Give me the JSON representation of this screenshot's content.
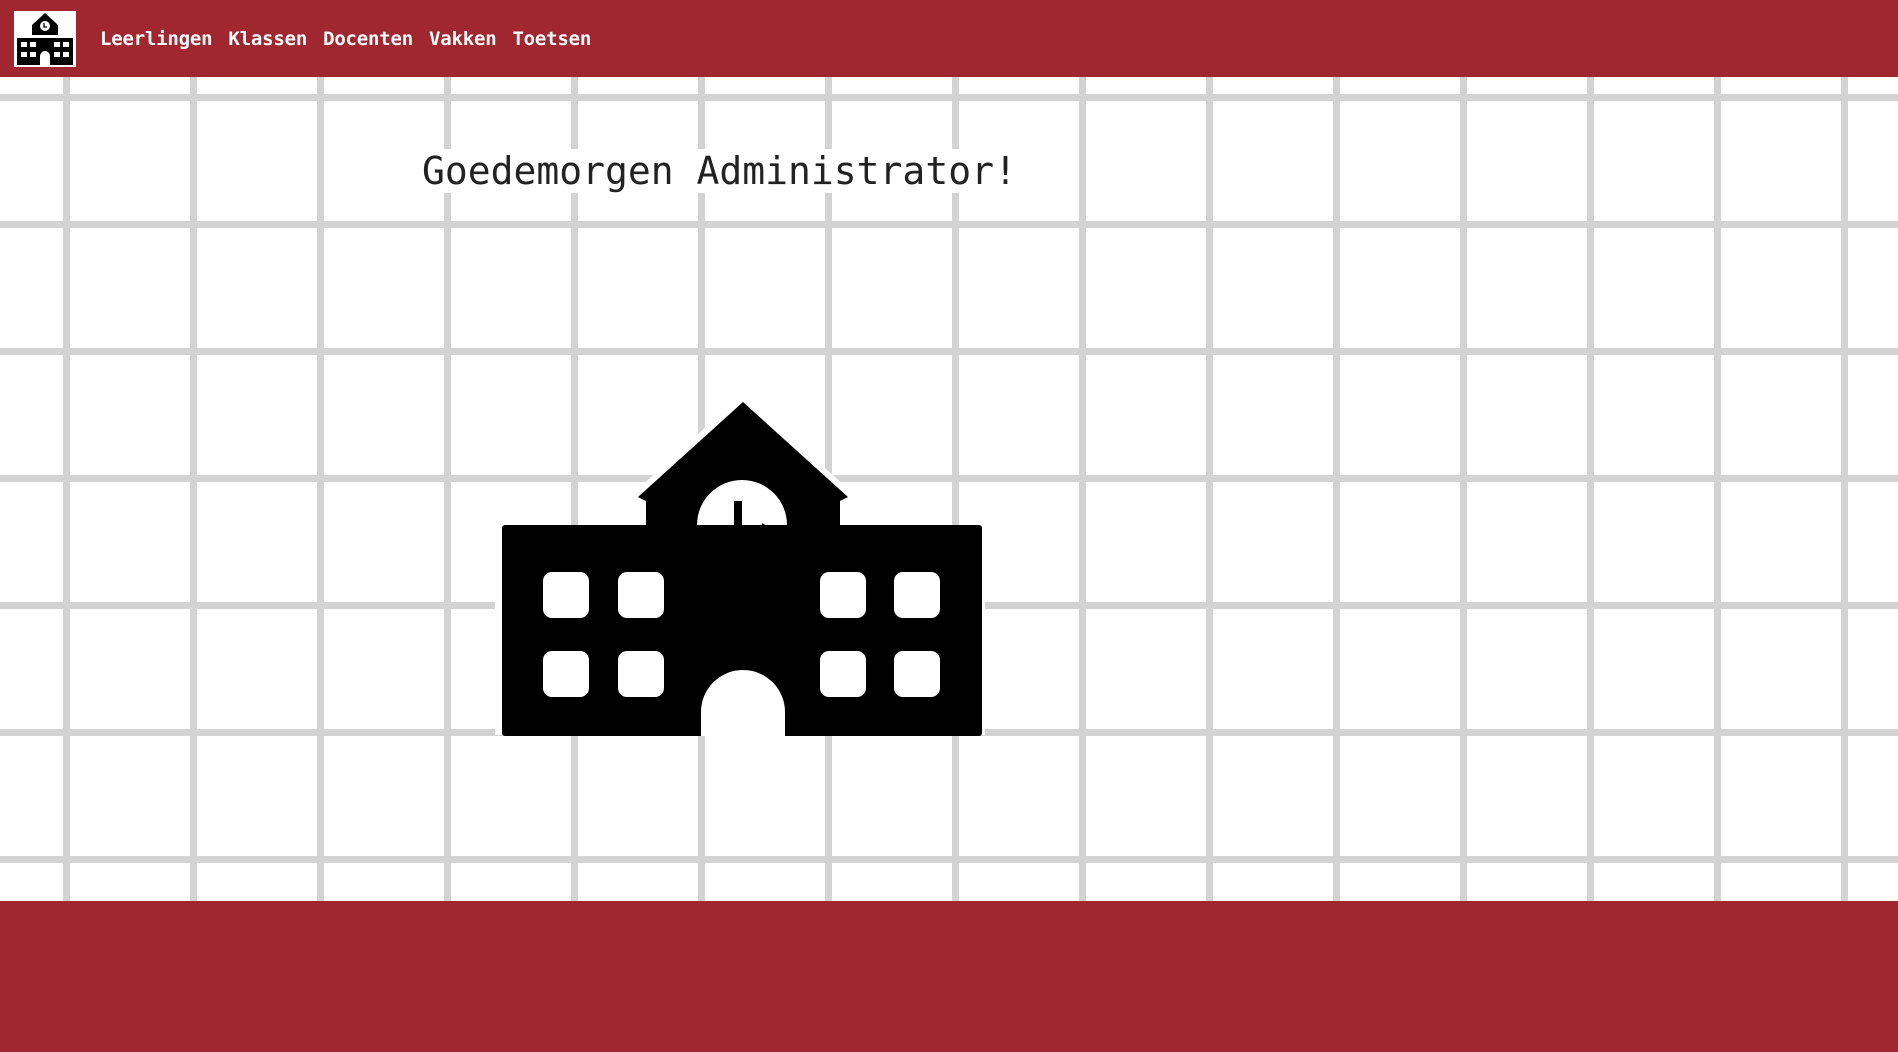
{
  "header": {
    "logo_icon": "school-building-icon",
    "nav": [
      {
        "label": "Leerlingen"
      },
      {
        "label": "Klassen"
      },
      {
        "label": "Docenten"
      },
      {
        "label": "Vakken"
      },
      {
        "label": "Toetsen"
      }
    ]
  },
  "main": {
    "greeting": "Goedemorgen Administrator!",
    "hero_icon": "school-building-icon"
  },
  "colors": {
    "brand": "#a0262f",
    "grid": "#d3d3d3",
    "background": "#ffffff",
    "icon": "#000000"
  }
}
